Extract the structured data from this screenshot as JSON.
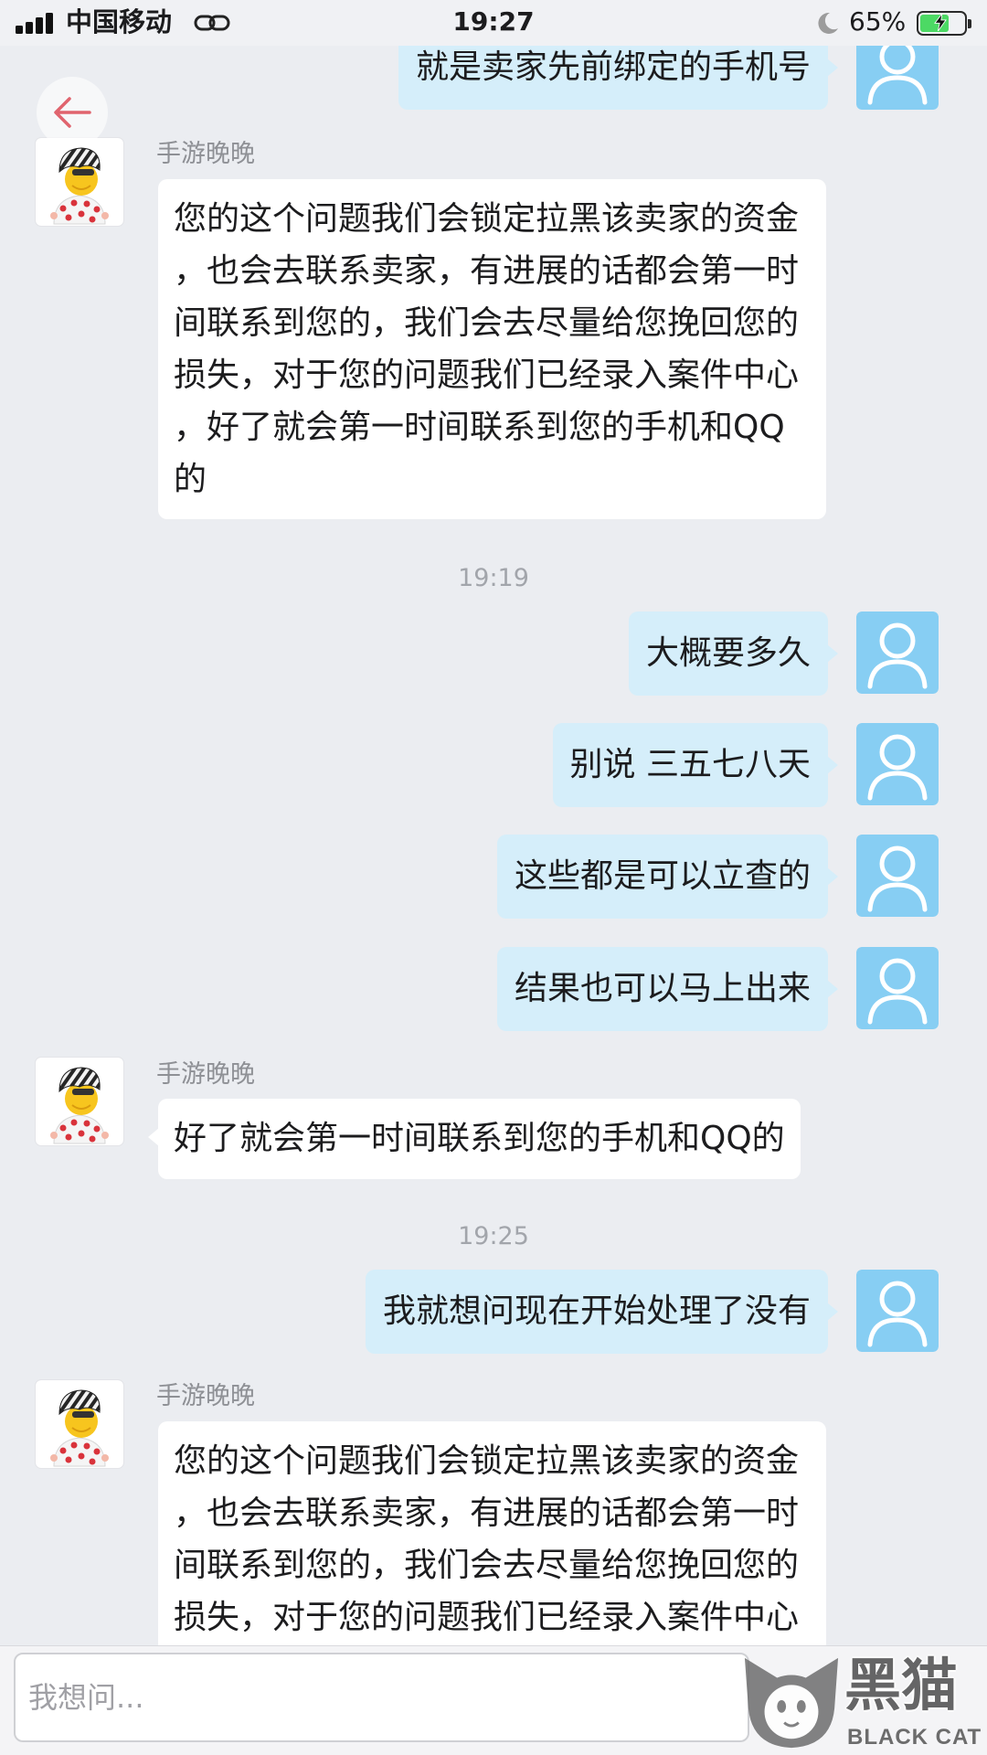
{
  "status_bar": {
    "carrier": "中国移动",
    "time": "19:27",
    "battery_percent": "65%",
    "battery_level": 0.65,
    "icons": [
      "signal-bars-icon",
      "hotspot-link-icon",
      "moon-icon",
      "battery-charging-icon"
    ]
  },
  "header": {
    "back_icon": "back-arrow-icon"
  },
  "avatars": {
    "self": "user-silhouette-icon",
    "service": "cartoon-avatar-icon"
  },
  "conversation": [
    {
      "sent": "就是卖家先前绑定的手机号"
    },
    {
      "received": {
        "sender": "手游晚晚",
        "lines": [
          "您的这个问题我们会锁定拉黑该卖家的资金",
          "，也会去联系卖家，有进展的话都会第一时",
          "间联系到您的，我们会去尽量给您挽回您的",
          "损失，对于您的问题我们已经录入案件中心",
          "，好了就会第一时间联系到您的手机和QQ",
          "的"
        ]
      }
    },
    {
      "time": "19:19"
    },
    {
      "sent": "大概要多久"
    },
    {
      "sent": "别说 三五七八天"
    },
    {
      "sent": "这些都是可以立查的"
    },
    {
      "sent": "结果也可以马上出来"
    },
    {
      "received": {
        "sender": "手游晚晚",
        "lines": [
          "好了就会第一时间联系到您的手机和QQ的"
        ]
      }
    },
    {
      "time": "19:25"
    },
    {
      "sent": "我就想问现在开始处理了没有"
    },
    {
      "received": {
        "sender": "手游晚晚",
        "lines": [
          "您的这个问题我们会锁定拉黑该卖家的资金",
          "，也会去联系卖家，有进展的话都会第一时",
          "间联系到您的，我们会去尽量给您挽回您的",
          "损失，对于您的问题我们已经录入案件中心"
        ]
      }
    }
  ],
  "input": {
    "placeholder": "我想问..."
  },
  "watermark": {
    "name_cn": "黑猫",
    "name_en": "BLACK CAT",
    "logo_icon": "cat-head-icon"
  },
  "colors": {
    "page_background": "#ebedf1",
    "outgoing_bubble": "#d5eefa",
    "incoming_bubble": "#ffffff",
    "self_avatar": "#87cef3",
    "back_arrow": "#e0646e",
    "battery_fill": "#4cd964",
    "timestamp_text": "#a2a5ab",
    "sender_text": "#8e9095"
  }
}
